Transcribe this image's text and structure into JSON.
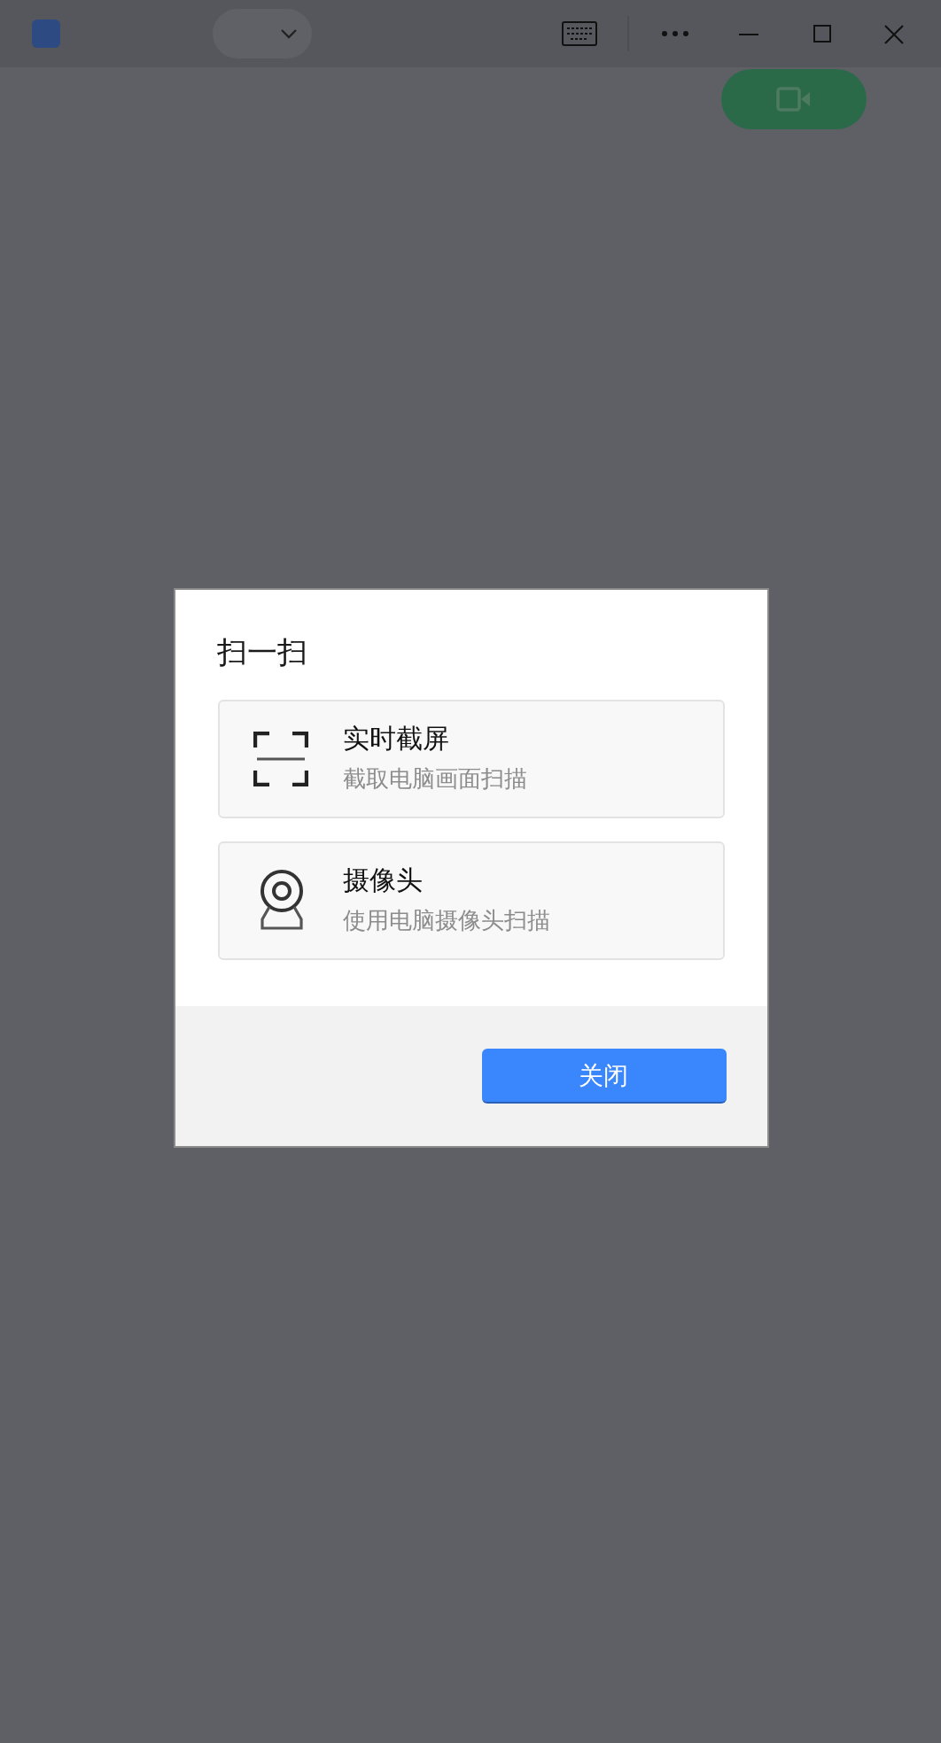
{
  "dialog": {
    "title": "扫一扫",
    "options": [
      {
        "kind": "screen",
        "title": "实时截屏",
        "subtitle": "截取电脑画面扫描"
      },
      {
        "kind": "camera",
        "title": "摄像头",
        "subtitle": "使用电脑摄像头扫描"
      }
    ],
    "close_button": "关闭"
  }
}
